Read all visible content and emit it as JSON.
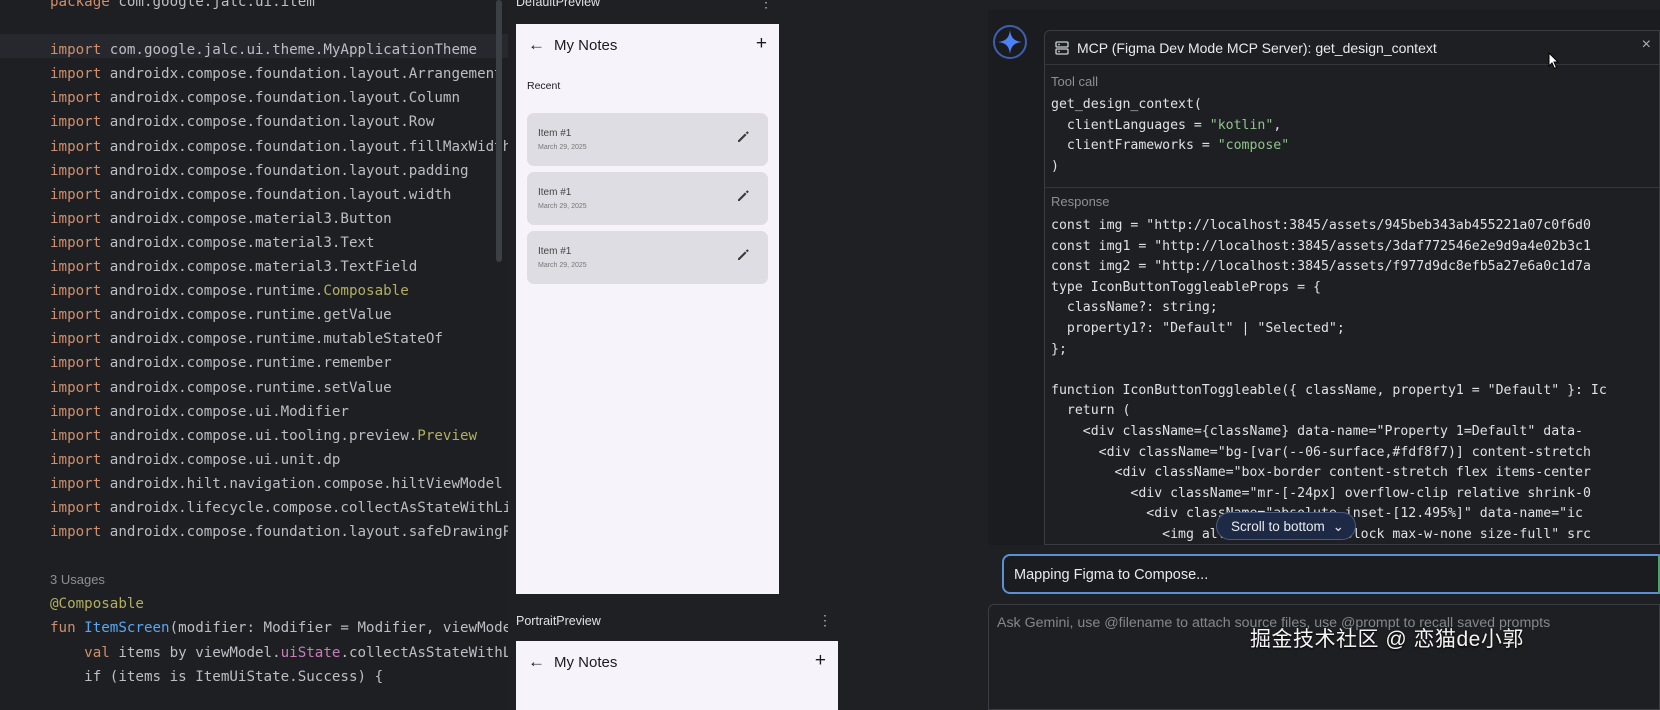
{
  "editor": {
    "lines": [
      [
        {
          "t": "package ",
          "c": "kw"
        },
        {
          "t": "com.google.jalc.ui.item",
          "c": "cls"
        }
      ],
      [
        {
          "t": "",
          "c": "cls"
        }
      ],
      [
        {
          "t": "import ",
          "c": "kw"
        },
        {
          "t": "com.google.jalc.ui.theme.MyApplicationTheme",
          "c": "cls"
        }
      ],
      [
        {
          "t": "import ",
          "c": "kw"
        },
        {
          "t": "androidx.compose.foundation.layout.Arrangement",
          "c": "cls"
        }
      ],
      [
        {
          "t": "import ",
          "c": "kw"
        },
        {
          "t": "androidx.compose.foundation.layout.Column",
          "c": "cls"
        }
      ],
      [
        {
          "t": "import ",
          "c": "kw"
        },
        {
          "t": "androidx.compose.foundation.layout.Row",
          "c": "cls"
        }
      ],
      [
        {
          "t": "import ",
          "c": "kw"
        },
        {
          "t": "androidx.compose.foundation.layout.fillMaxWidth",
          "c": "cls"
        }
      ],
      [
        {
          "t": "import ",
          "c": "kw"
        },
        {
          "t": "androidx.compose.foundation.layout.padding",
          "c": "cls"
        }
      ],
      [
        {
          "t": "import ",
          "c": "kw"
        },
        {
          "t": "androidx.compose.foundation.layout.width",
          "c": "cls"
        }
      ],
      [
        {
          "t": "import ",
          "c": "kw"
        },
        {
          "t": "androidx.compose.material3.Button",
          "c": "cls"
        }
      ],
      [
        {
          "t": "import ",
          "c": "kw"
        },
        {
          "t": "androidx.compose.material3.Text",
          "c": "cls"
        }
      ],
      [
        {
          "t": "import ",
          "c": "kw"
        },
        {
          "t": "androidx.compose.material3.TextField",
          "c": "cls"
        }
      ],
      [
        {
          "t": "import ",
          "c": "kw"
        },
        {
          "t": "androidx.compose.runtime.",
          "c": "cls"
        },
        {
          "t": "Composable",
          "c": "ann"
        }
      ],
      [
        {
          "t": "import ",
          "c": "kw"
        },
        {
          "t": "androidx.compose.runtime.getValue",
          "c": "cls"
        }
      ],
      [
        {
          "t": "import ",
          "c": "kw"
        },
        {
          "t": "androidx.compose.runtime.mutableStateOf",
          "c": "cls"
        }
      ],
      [
        {
          "t": "import ",
          "c": "kw"
        },
        {
          "t": "androidx.compose.runtime.remember",
          "c": "cls"
        }
      ],
      [
        {
          "t": "import ",
          "c": "kw"
        },
        {
          "t": "androidx.compose.runtime.setValue",
          "c": "cls"
        }
      ],
      [
        {
          "t": "import ",
          "c": "kw"
        },
        {
          "t": "androidx.compose.ui.Modifier",
          "c": "cls"
        }
      ],
      [
        {
          "t": "import ",
          "c": "kw"
        },
        {
          "t": "androidx.compose.ui.tooling.preview.",
          "c": "cls"
        },
        {
          "t": "Preview",
          "c": "ann"
        }
      ],
      [
        {
          "t": "import ",
          "c": "kw"
        },
        {
          "t": "androidx.compose.ui.unit.dp",
          "c": "cls"
        }
      ],
      [
        {
          "t": "import ",
          "c": "kw"
        },
        {
          "t": "androidx.hilt.navigation.compose.hiltViewModel",
          "c": "cls"
        }
      ],
      [
        {
          "t": "import ",
          "c": "kw"
        },
        {
          "t": "androidx.lifecycle.compose.collectAsStateWithLifecycle",
          "c": "cls"
        }
      ],
      [
        {
          "t": "import ",
          "c": "kw"
        },
        {
          "t": "androidx.compose.foundation.layout.safeDrawingPadding",
          "c": "cls"
        }
      ],
      [
        {
          "t": "",
          "c": "cls"
        }
      ],
      [
        {
          "t": "3 Usages",
          "c": "usage"
        }
      ],
      [
        {
          "t": "@Composable",
          "c": "ann"
        }
      ],
      [
        {
          "t": "fun ",
          "c": "kw"
        },
        {
          "t": "ItemScreen",
          "c": "fn"
        },
        {
          "t": "(modifier: Modifier = Modifier, viewModel: ItemViewModel",
          "c": "cls"
        }
      ],
      [
        {
          "t": "    val ",
          "c": "kw"
        },
        {
          "t": "items by viewModel.",
          "c": "cls"
        },
        {
          "t": "uiState",
          "c": "prop"
        },
        {
          "t": ".",
          "c": "cls"
        },
        {
          "t": "collectAsStateWithLifecycle",
          "c": "cls"
        }
      ],
      [
        {
          "t": "    if (items is ItemUiState.Success) {",
          "c": "cls"
        }
      ]
    ]
  },
  "preview": {
    "default_title": "DefaultPreview",
    "portrait_title": "PortraitPreview",
    "menu_glyph": "⋮",
    "app_title": "My Notes",
    "back_glyph": "←",
    "add_glyph": "+",
    "section": "Recent",
    "notes": [
      {
        "title": "Item #1",
        "date": "March 29, 2025"
      },
      {
        "title": "Item #1",
        "date": "March 29, 2025"
      },
      {
        "title": "Item #1",
        "date": "March 29, 2025"
      }
    ]
  },
  "assistant": {
    "card_title": "MCP (Figma Dev Mode MCP Server): get_design_context",
    "close_glyph": "×",
    "tool_call_label": "Tool call",
    "tool_call": [
      [
        {
          "t": "get_design_context(",
          "c": ""
        }
      ],
      [
        {
          "t": "  clientLanguages = ",
          "c": ""
        },
        {
          "t": "\"kotlin\"",
          "c": "str"
        },
        {
          "t": ",",
          "c": ""
        }
      ],
      [
        {
          "t": "  clientFrameworks = ",
          "c": ""
        },
        {
          "t": "\"compose\"",
          "c": "str"
        }
      ],
      [
        {
          "t": ")",
          "c": ""
        }
      ]
    ],
    "response_label": "Response",
    "response": [
      "const img = \"http://localhost:3845/assets/945beb343ab455221a07c0f6d0",
      "const img1 = \"http://localhost:3845/assets/3daf772546e2e9d9a4e02b3c1",
      "const img2 = \"http://localhost:3845/assets/f977d9dc8efb5a27e6a0c1d7a",
      "type IconButtonToggleableProps = {",
      "  className?: string;",
      "  property1?: \"Default\" | \"Selected\";",
      "};",
      "",
      "function IconButtonToggleable({ className, property1 = \"Default\" }: Ic",
      "  return (",
      "    <div className={className} data-name=\"Property 1=Default\" data-",
      "      <div className=\"bg-[var(--06-surface,#fdf8f7)] content-stretch",
      "        <div className=\"box-border content-stretch flex items-center",
      "          <div className=\"mr-[-24px] overflow-clip relative shrink-0",
      "            <div className=\"absolute inset-[12.495%]\" data-name=\"ic",
      "              <img alt=\"\" className=\"block max-w-none size-full\" src"
    ],
    "scroll_button": "Scroll to bottom",
    "scroll_chevron": "⌄",
    "status": "Mapping Figma to Compose...",
    "prompt_placeholder": "Ask Gemini, use @filename to attach source files, use @prompt to recall saved prompts"
  },
  "watermark": "掘金技术社区 @ 恋猫de小郭",
  "colors": {
    "accent_blue": "#5b8fd6",
    "gemini_blue": "#4c82f7",
    "keyword": "#cf8e6d",
    "annotation": "#b3ae60",
    "string": "#8fc58b"
  }
}
